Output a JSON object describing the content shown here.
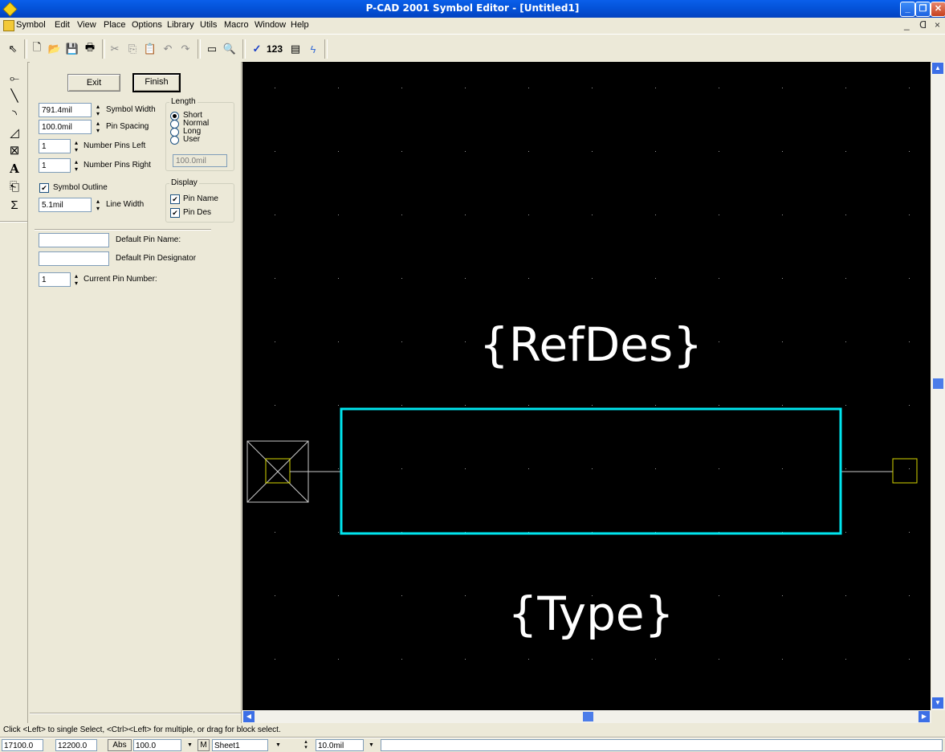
{
  "window": {
    "title": "P-CAD 2001 Symbol Editor - [Untitled1]"
  },
  "menu": {
    "items": [
      "Symbol",
      "Edit",
      "View",
      "Place",
      "Options",
      "Library",
      "Utils",
      "Macro",
      "Window",
      "Help"
    ]
  },
  "toolbar": {
    "count_label": "123"
  },
  "panel": {
    "exit_label": "Exit",
    "finish_label": "Finish",
    "symbol_width": {
      "value": "791.4mil",
      "label": "Symbol Width"
    },
    "pin_spacing": {
      "value": "100.0mil",
      "label": "Pin Spacing"
    },
    "pins_left": {
      "value": "1",
      "label": "Number Pins Left"
    },
    "pins_right": {
      "value": "1",
      "label": "Number Pins Right"
    },
    "symbol_outline": {
      "label": "Symbol Outline",
      "checked": true
    },
    "line_width": {
      "value": "5.1mil",
      "label": "Line Width"
    },
    "length": {
      "title": "Length",
      "options": [
        "Short",
        "Normal",
        "Long",
        "User"
      ],
      "selected": "Short",
      "user_value": "100.0mil"
    },
    "display": {
      "title": "Display",
      "pin_name": "Pin Name",
      "pin_des": "Pin Des"
    },
    "default_pin_name": {
      "value": "",
      "label": "Default Pin Name:"
    },
    "default_pin_designator": {
      "value": "",
      "label": "Default Pin Designator"
    },
    "current_pin": {
      "value": "1",
      "label": "Current Pin Number:"
    }
  },
  "canvas": {
    "refdes_text": "{RefDes}",
    "type_text": "{Type}",
    "outline_color": "#00E5EE",
    "background": "#000000"
  },
  "status": {
    "message": "Click <Left> to single Select, <Ctrl><Left> for multiple, or drag for block select.",
    "x": "17100.0",
    "y": "12200.0",
    "abs_label": "Abs",
    "zoom": "100.0",
    "m_label": "M",
    "sheet": "Sheet1",
    "grid": "10.0mil"
  }
}
